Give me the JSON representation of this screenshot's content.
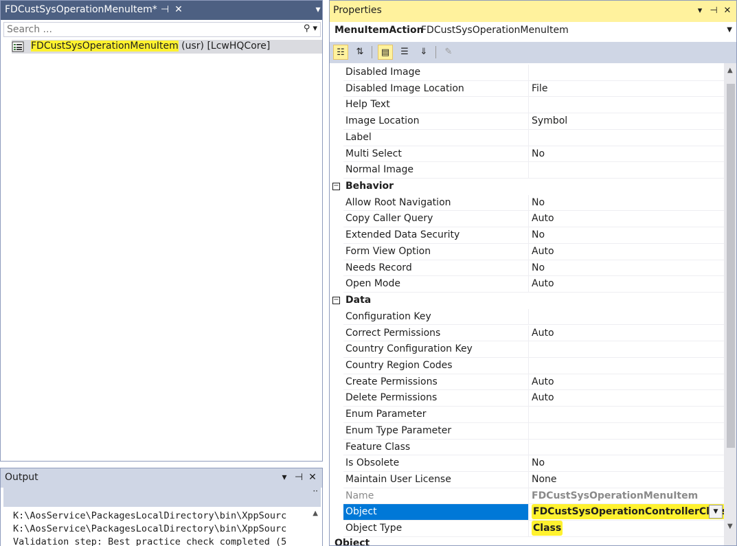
{
  "designer": {
    "title": "FDCustSysOperationMenuItem*",
    "search_placeholder": "Search ...",
    "node": {
      "name": "FDCustSysOperationMenuItem",
      "suffix": " (usr) [LcwHQCore]"
    }
  },
  "output": {
    "title": "Output",
    "lines": [
      "K:\\AosService\\PackagesLocalDirectory\\bin\\XppSourc",
      "K:\\AosService\\PackagesLocalDirectory\\bin\\XppSourc",
      "Validation step: Best practice check completed (5"
    ]
  },
  "properties": {
    "title": "Properties",
    "object_type": "MenuItemAction",
    "object_name": "FDCustSysOperationMenuItem",
    "rows": [
      {
        "kind": "prop",
        "name": "Disabled Image",
        "value": ""
      },
      {
        "kind": "prop",
        "name": "Disabled Image Location",
        "value": "File"
      },
      {
        "kind": "prop",
        "name": "Help Text",
        "value": ""
      },
      {
        "kind": "prop",
        "name": "Image Location",
        "value": "Symbol"
      },
      {
        "kind": "prop",
        "name": "Label",
        "value": ""
      },
      {
        "kind": "prop",
        "name": "Multi Select",
        "value": "No"
      },
      {
        "kind": "prop",
        "name": "Normal Image",
        "value": ""
      },
      {
        "kind": "cat",
        "name": "Behavior"
      },
      {
        "kind": "prop",
        "name": "Allow Root Navigation",
        "value": "No"
      },
      {
        "kind": "prop",
        "name": "Copy Caller Query",
        "value": "Auto"
      },
      {
        "kind": "prop",
        "name": "Extended Data Security",
        "value": "No"
      },
      {
        "kind": "prop",
        "name": "Form View Option",
        "value": "Auto"
      },
      {
        "kind": "prop",
        "name": "Needs Record",
        "value": "No"
      },
      {
        "kind": "prop",
        "name": "Open Mode",
        "value": "Auto"
      },
      {
        "kind": "cat",
        "name": "Data"
      },
      {
        "kind": "prop",
        "name": "Configuration Key",
        "value": ""
      },
      {
        "kind": "prop",
        "name": "Correct Permissions",
        "value": "Auto"
      },
      {
        "kind": "prop",
        "name": "Country Configuration Key",
        "value": ""
      },
      {
        "kind": "prop",
        "name": "Country Region Codes",
        "value": ""
      },
      {
        "kind": "prop",
        "name": "Create Permissions",
        "value": "Auto"
      },
      {
        "kind": "prop",
        "name": "Delete Permissions",
        "value": "Auto"
      },
      {
        "kind": "prop",
        "name": "Enum Parameter",
        "value": ""
      },
      {
        "kind": "prop",
        "name": "Enum Type Parameter",
        "value": ""
      },
      {
        "kind": "prop",
        "name": "Feature Class",
        "value": ""
      },
      {
        "kind": "prop",
        "name": "Is Obsolete",
        "value": "No"
      },
      {
        "kind": "prop",
        "name": "Maintain User License",
        "value": "None"
      },
      {
        "kind": "prop",
        "name": "Name",
        "value": "FDCustSysOperationMenuItem",
        "state": "dim"
      },
      {
        "kind": "prop",
        "name": "Object",
        "value": "FDCustSysOperationControllerClass",
        "state": "selected",
        "highlight": true
      },
      {
        "kind": "prop",
        "name": "Object Type",
        "value": "Class",
        "highlight": true
      }
    ],
    "footer_label": "Object"
  },
  "colors": {
    "active_title": "#fff29d",
    "tool_title": "#4d6082",
    "selection": "#0078d7",
    "marker": "#fff22f"
  }
}
